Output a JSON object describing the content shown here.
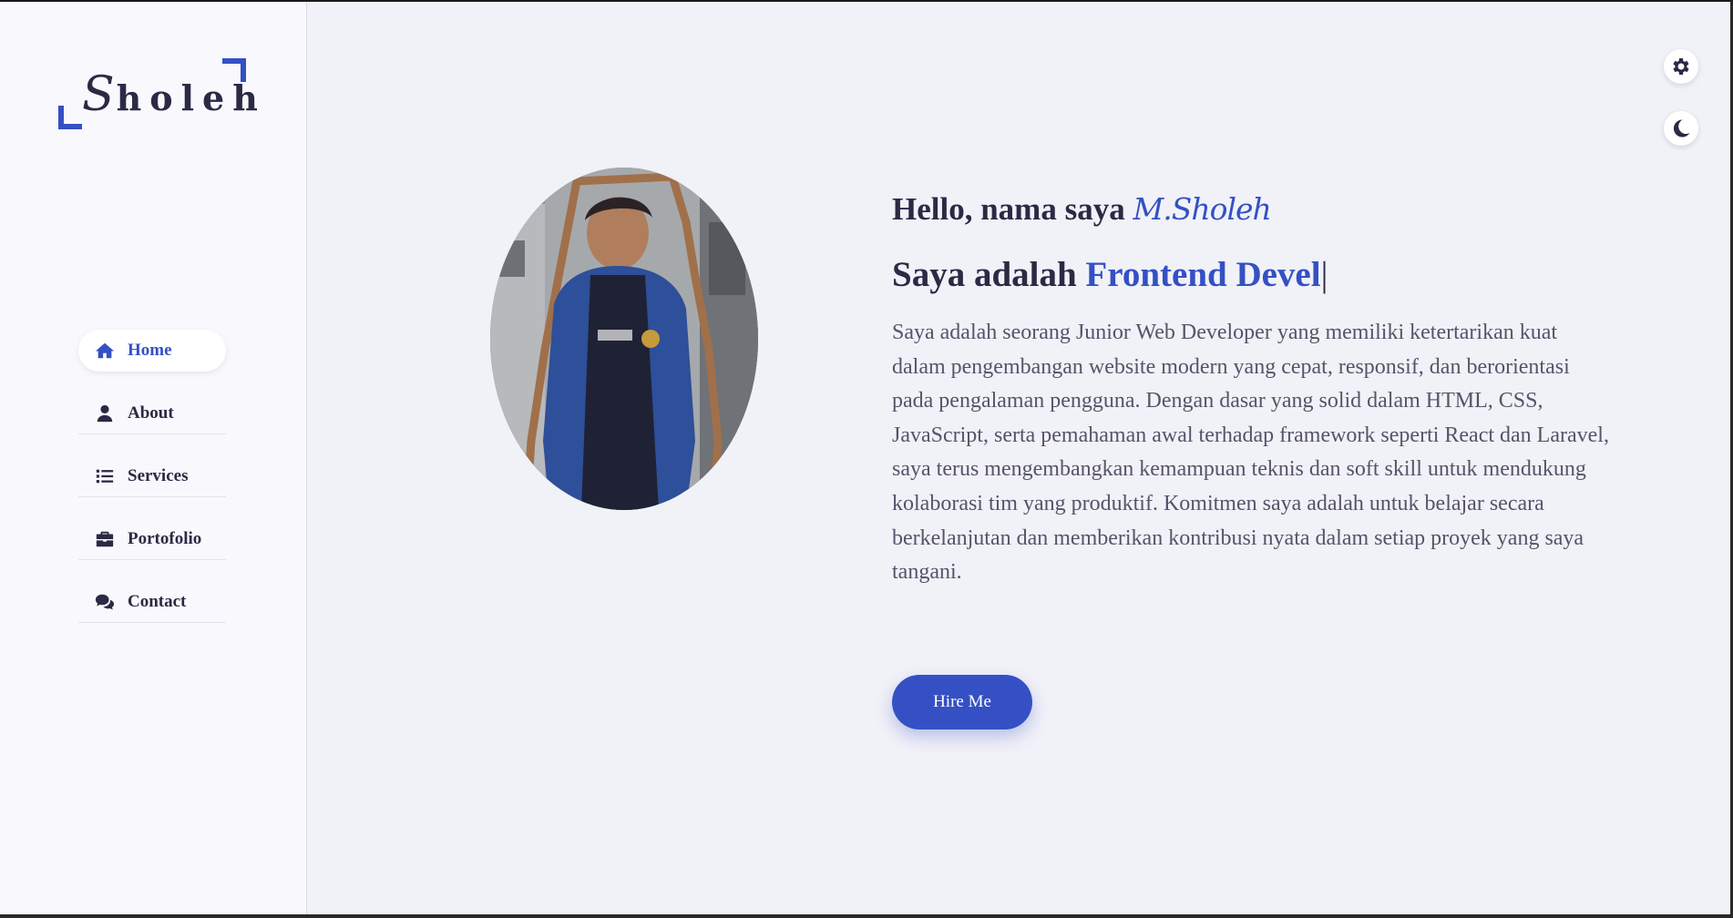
{
  "logo": {
    "first_letter": "S",
    "rest": "holeh"
  },
  "nav": {
    "items": [
      {
        "label": "Home",
        "icon": "home-icon",
        "active": true
      },
      {
        "label": "About",
        "icon": "user-icon",
        "active": false
      },
      {
        "label": "Services",
        "icon": "list-icon",
        "active": false
      },
      {
        "label": "Portofolio",
        "icon": "briefcase-icon",
        "active": false
      },
      {
        "label": "Contact",
        "icon": "comments-icon",
        "active": false
      }
    ]
  },
  "floating": {
    "settings_icon": "gear-icon",
    "theme_icon": "moon-icon"
  },
  "hero": {
    "greeting_prefix": "Hello, nama saya ",
    "name": "M.Sholeh",
    "role_prefix": "Saya adalah ",
    "role_typed": "Frontend Devel",
    "cursor": "|",
    "description": "Saya adalah seorang Junior Web Developer yang memiliki ketertarikan kuat dalam pengembangan website modern yang cepat, responsif, dan berorientasi pada pengalaman pengguna. Dengan dasar yang solid dalam HTML, CSS, JavaScript, serta pemahaman awal terhadap framework seperti React dan Laravel, saya terus mengembangkan kemampuan teknis dan soft skill untuk mendukung kolaborasi tim yang produktif. Komitmen saya adalah untuk belajar secara berkelanjutan dan memberikan kontribusi nyata dalam setiap proyek yang saya tangani.",
    "button_label": "Hire Me"
  },
  "colors": {
    "accent": "#3450c4",
    "text": "#2b2a45",
    "muted": "#555468",
    "bg": "#f1f1f8",
    "sidebar": "#f9f9fd"
  }
}
